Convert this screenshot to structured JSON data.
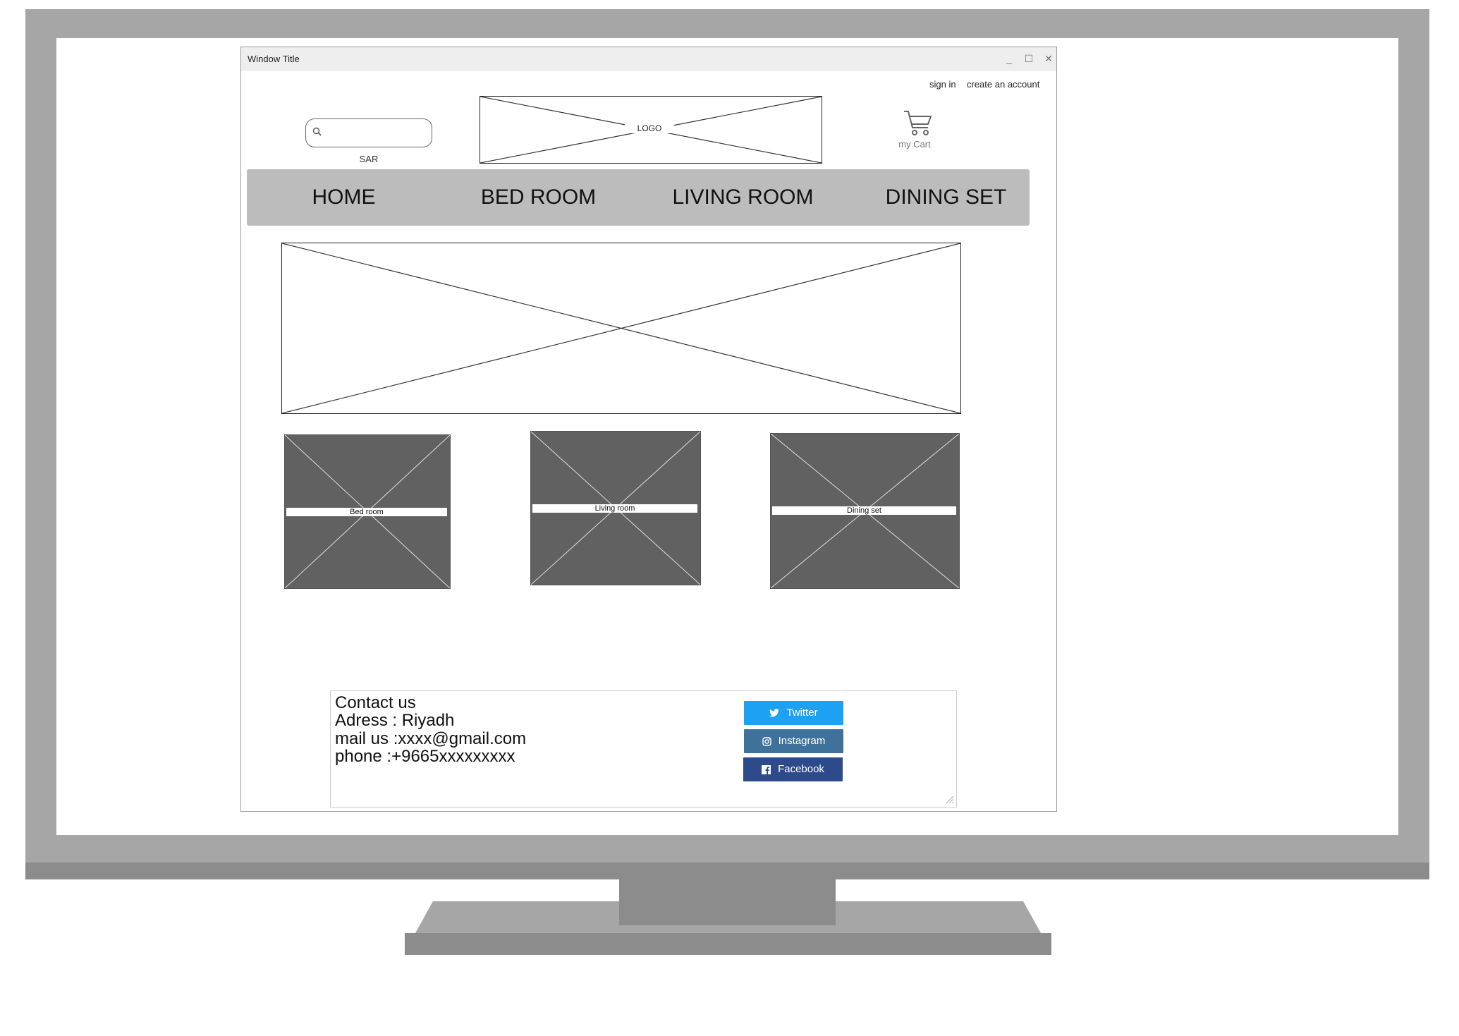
{
  "window": {
    "title": "Window Title",
    "minimize": "_",
    "maximize": "☐",
    "close": "✕"
  },
  "account": {
    "sign_in": "sign in",
    "create_account": "create an account"
  },
  "search": {
    "placeholder": "",
    "value": ""
  },
  "currency": "SAR",
  "logo": "LOGO",
  "cart": {
    "label": "my Cart"
  },
  "nav": {
    "home": "HOME",
    "bed_room": "BED ROOM",
    "living_room": "LIVING ROOM",
    "dining_set": "DINING SET"
  },
  "categories": [
    {
      "label": "Bed room"
    },
    {
      "label": "Living room"
    },
    {
      "label": "Dining set"
    }
  ],
  "contact": {
    "heading": "Contact  us",
    "address": "Adress : Riyadh",
    "mail": "mail us :xxxx@gmail.com",
    "phone": "phone :+9665xxxxxxxxx"
  },
  "social": {
    "twitter": "Twitter",
    "instagram": "Instagram",
    "facebook": "Facebook"
  },
  "colors": {
    "twitter": "#1da1f2",
    "instagram": "#3f729b",
    "facebook": "#2d4a8a",
    "nav_bar": "#bcbcbc",
    "card_fill": "#616161"
  }
}
